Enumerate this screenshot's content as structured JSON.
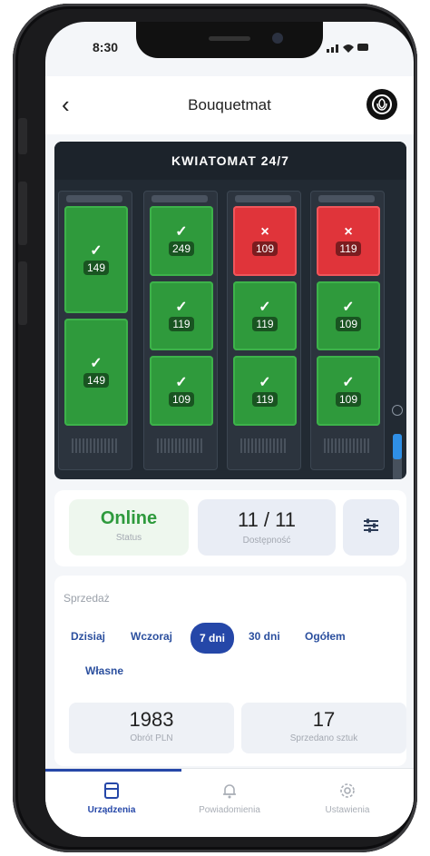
{
  "status_bar": {
    "time": "8:30",
    "icons": "signal-wifi-battery"
  },
  "header": {
    "title": "Bouquetmat",
    "back_icon": "chevron-left-icon",
    "logo_icon": "flower-logo-icon"
  },
  "machine": {
    "title": "KWIATOMAT 24/7",
    "columns": [
      {
        "slots": [
          {
            "status": "ok",
            "mark": "✓",
            "price": "149"
          },
          {
            "status": "ok",
            "mark": "✓",
            "price": "149"
          }
        ]
      },
      {
        "slots": [
          {
            "status": "ok",
            "mark": "✓",
            "price": "249"
          },
          {
            "status": "ok",
            "mark": "✓",
            "price": "119"
          },
          {
            "status": "ok",
            "mark": "✓",
            "price": "109"
          }
        ]
      },
      {
        "slots": [
          {
            "status": "sold",
            "mark": "×",
            "price": "109"
          },
          {
            "status": "ok",
            "mark": "✓",
            "price": "119"
          },
          {
            "status": "ok",
            "mark": "✓",
            "price": "119"
          }
        ]
      },
      {
        "slots": [
          {
            "status": "sold",
            "mark": "×",
            "price": "119"
          },
          {
            "status": "ok",
            "mark": "✓",
            "price": "109"
          },
          {
            "status": "ok",
            "mark": "✓",
            "price": "109"
          }
        ]
      }
    ],
    "colors": {
      "ok": "#2f9a3c",
      "sold": "#e0343a",
      "background": "#222a33"
    }
  },
  "status": {
    "online_value": "Online",
    "online_label": "Status",
    "availability_value": "11 / 11",
    "availability_label": "Dostępność",
    "settings_icon": "sliders-icon"
  },
  "sales": {
    "title": "Sprzedaż",
    "ranges": [
      "Dzisiaj",
      "Wczoraj",
      "7 dni",
      "30 dni",
      "Ogółem",
      "Własne"
    ],
    "active_range": "7 dni",
    "turnover_value": "1983",
    "turnover_label": "Obrót PLN",
    "sold_value": "17",
    "sold_label": "Sprzedano sztuk"
  },
  "nav": {
    "items": [
      {
        "label": "Urządzenia",
        "icon": "device-icon"
      },
      {
        "label": "Powiadomienia",
        "icon": "bell-icon"
      },
      {
        "label": "Ustawienia",
        "icon": "gear-icon"
      }
    ],
    "active": "Urządzenia"
  },
  "accent_color": "#2547a8"
}
